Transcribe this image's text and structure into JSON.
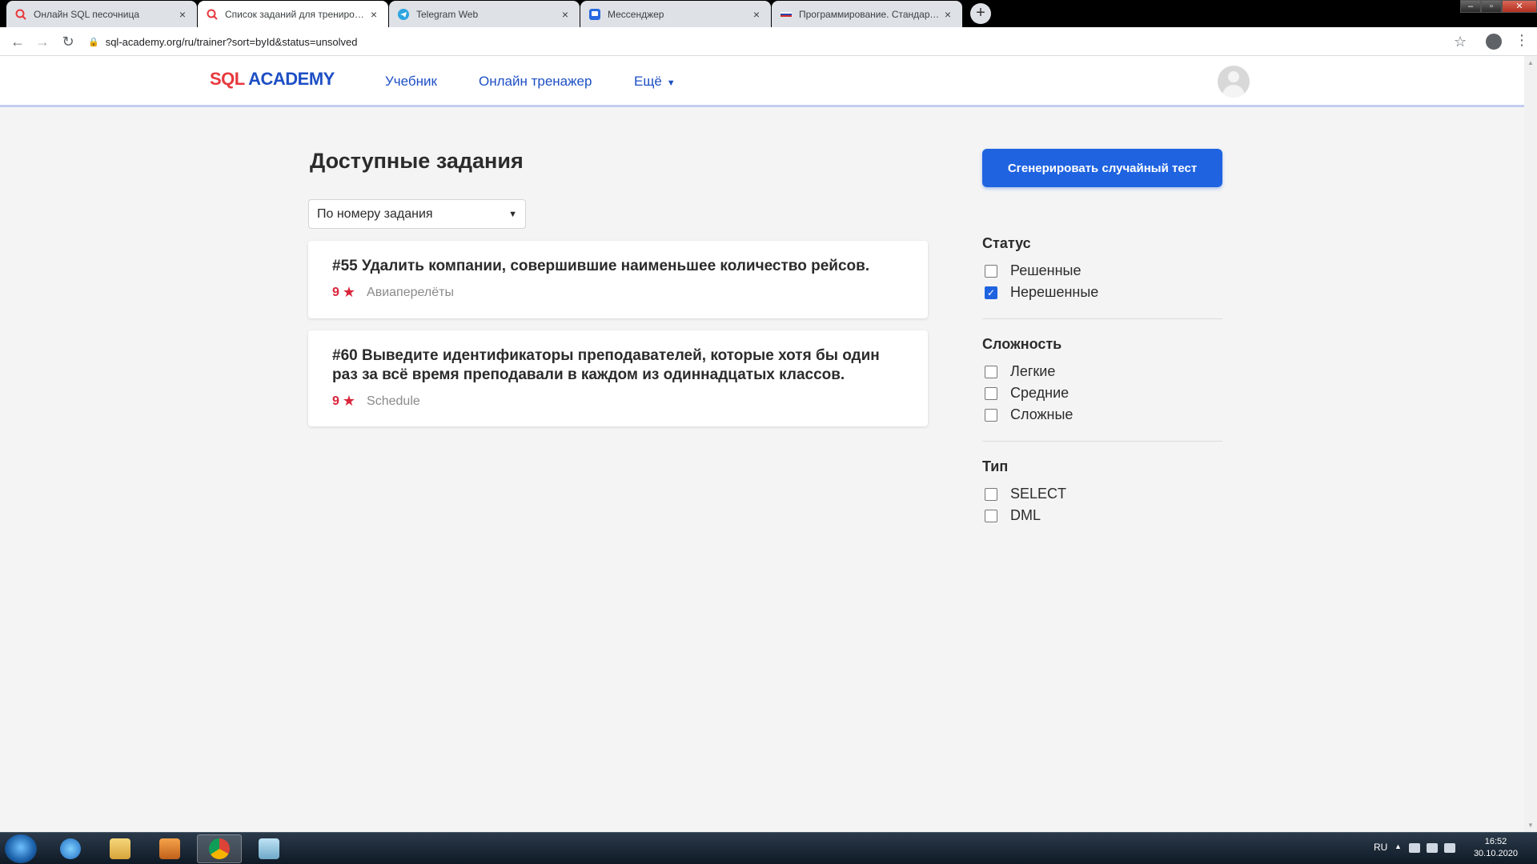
{
  "browser": {
    "tabs": [
      {
        "title": "Онлайн SQL песочница",
        "icon": "sql-academy-favicon",
        "active": false
      },
      {
        "title": "Список заданий для тренировки SQL",
        "icon": "sql-academy-favicon",
        "active": true
      },
      {
        "title": "Telegram Web",
        "icon": "telegram-icon",
        "active": false
      },
      {
        "title": "Мессенджер",
        "icon": "messenger-icon",
        "active": false
      },
      {
        "title": "Программирование. Стандартные",
        "icon": "flag-favicon",
        "active": false
      }
    ],
    "close_glyph": "×",
    "new_tab_glyph": "+",
    "url": "sql-academy.org/ru/trainer?sort=byId&status=unsolved",
    "window_controls": {
      "minimize": "–",
      "maximize": "▫",
      "close": "✕"
    }
  },
  "site": {
    "logo": {
      "part1": "SQL",
      "part2": "ACADEMY"
    },
    "nav": {
      "textbook": "Учебник",
      "trainer": "Онлайн тренажер",
      "more": "Ещё"
    }
  },
  "main": {
    "title": "Доступные задания",
    "sort": {
      "selected": "По номеру задания"
    },
    "tasks": [
      {
        "title": "#55 Удалить компании, совершившие наименьшее количество рейсов.",
        "points": "9",
        "database": "Авиаперелёты"
      },
      {
        "title": "#60 Выведите идентификаторы преподавателей, которые хотя бы один раз за всё время преподавали в каждом из одиннадцатых классов.",
        "points": "9",
        "database": "Schedule"
      }
    ]
  },
  "sidebar": {
    "random_test_button": "Сгенерировать случайный тест",
    "status": {
      "title": "Статус",
      "options": [
        {
          "label": "Решенные",
          "checked": false
        },
        {
          "label": "Нерешенные",
          "checked": true
        }
      ]
    },
    "difficulty": {
      "title": "Сложность",
      "options": [
        {
          "label": "Легкие",
          "checked": false
        },
        {
          "label": "Средние",
          "checked": false
        },
        {
          "label": "Сложные",
          "checked": false
        }
      ]
    },
    "type": {
      "title": "Тип",
      "options": [
        {
          "label": "SELECT",
          "checked": false
        },
        {
          "label": "DML",
          "checked": false
        }
      ]
    }
  },
  "taskbar": {
    "language": "RU",
    "time": "16:52",
    "date": "30.10.2020"
  },
  "colors": {
    "brand_red": "#e8383d",
    "brand_blue": "#1d4fc4",
    "button_blue": "#1f63e0",
    "points_red": "#d9243a"
  }
}
